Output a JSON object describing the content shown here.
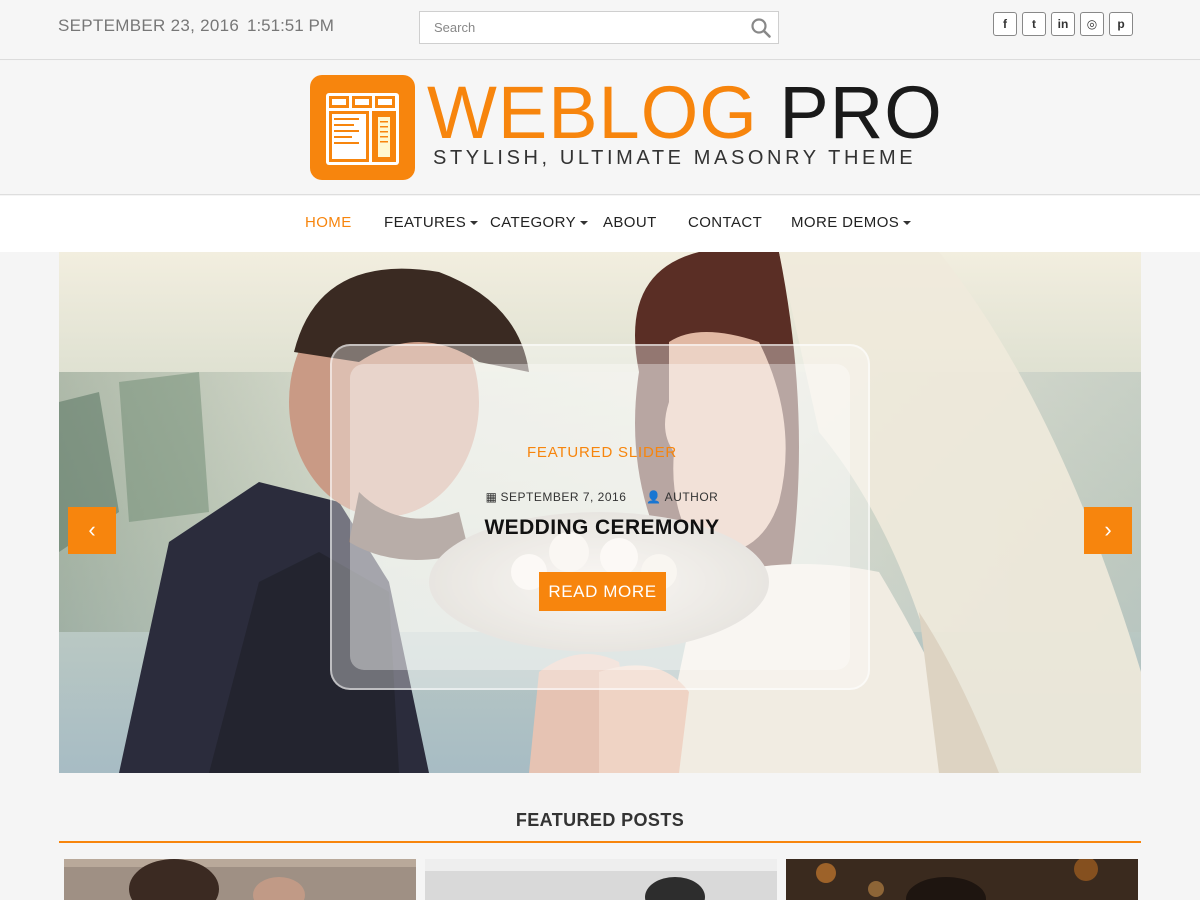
{
  "topbar": {
    "date": "SEPTEMBER 23, 2016",
    "time": "1:51:51 PM",
    "search_placeholder": "Search",
    "social": [
      {
        "icon": "facebook-icon",
        "glyph": "f"
      },
      {
        "icon": "twitter-icon",
        "glyph": "t"
      },
      {
        "icon": "linkedin-icon",
        "glyph": "in"
      },
      {
        "icon": "instagram-icon",
        "glyph": "◎"
      },
      {
        "icon": "pinterest-icon",
        "glyph": "p"
      }
    ]
  },
  "header": {
    "title_part1": "WEBLOG",
    "title_part2": "PRO",
    "tagline": "STYLISH, ULTIMATE MASONRY THEME"
  },
  "nav": {
    "items": [
      {
        "label": "HOME",
        "active": true,
        "dropdown": false
      },
      {
        "label": "FEATURES",
        "active": false,
        "dropdown": true
      },
      {
        "label": "CATEGORY",
        "active": false,
        "dropdown": true
      },
      {
        "label": "ABOUT",
        "active": false,
        "dropdown": false
      },
      {
        "label": "CONTACT",
        "active": false,
        "dropdown": false
      },
      {
        "label": "MORE DEMOS",
        "active": false,
        "dropdown": true
      }
    ]
  },
  "slider": {
    "category": "FEATURED SLIDER",
    "date": "SEPTEMBER 7, 2016",
    "author": "AUTHOR",
    "title": "WEDDING CEREMONY",
    "button": "READ MORE",
    "prev_glyph": "‹",
    "next_glyph": "›"
  },
  "featured": {
    "title": "FEATURED POSTS"
  },
  "colors": {
    "accent": "#f7850d",
    "text": "#222222",
    "muted": "#777777"
  }
}
